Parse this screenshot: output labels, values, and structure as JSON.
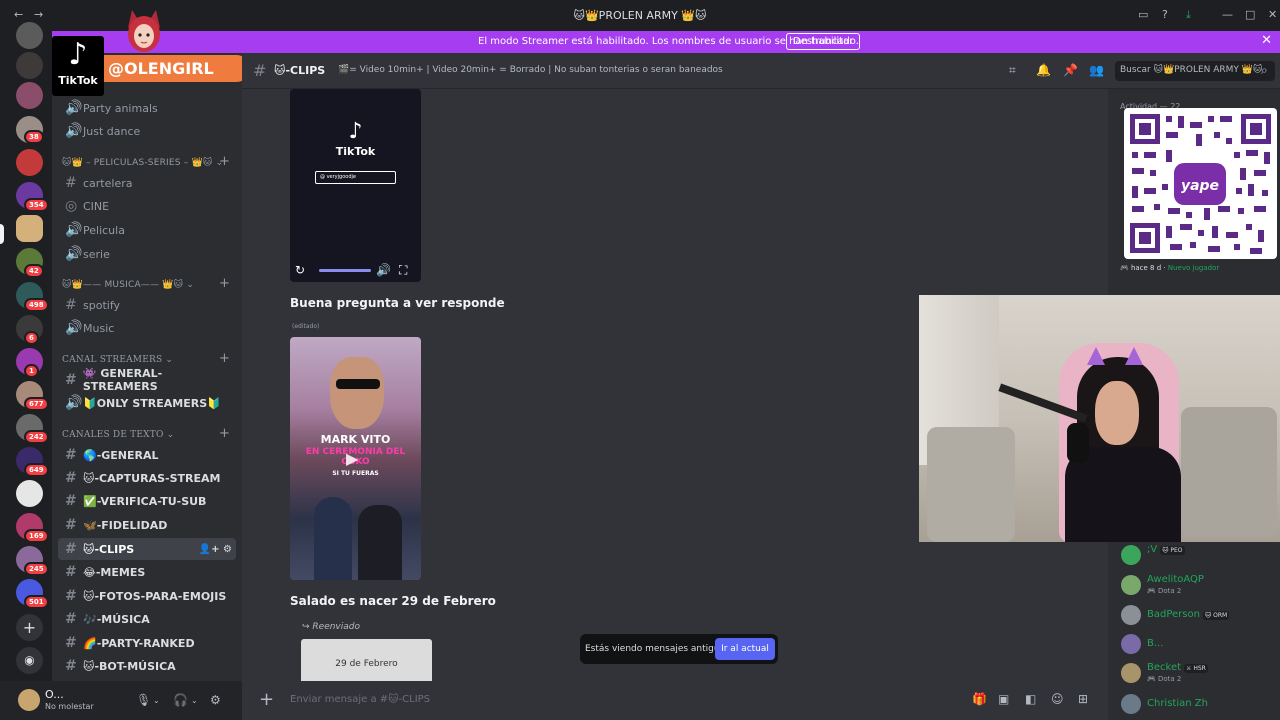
{
  "window": {
    "title": "🐱👑PROLEN ARMY 👑🐱",
    "back": "←",
    "forward": "→",
    "controls": [
      "▭",
      "?",
      "⤓",
      "—",
      "□",
      "✕"
    ]
  },
  "banner": {
    "text": "El modo Streamer está habilitado. Los nombres de usuario se han truncado.",
    "button": "Deshabilitar",
    "close": "✕"
  },
  "overlay": {
    "tiktok_label": "TikTok",
    "handle": "@OLENGIRL"
  },
  "servers": {
    "badges": [
      "38",
      "354",
      "42",
      "498",
      "6",
      "1",
      "677",
      "242",
      "649",
      "169",
      "245",
      "501"
    ],
    "add_icon": "+",
    "discover_icon": "◉"
  },
  "channels": {
    "items_top": [
      {
        "icon": "🔊",
        "label": "Party animals"
      },
      {
        "icon": "🔊",
        "label": "Just dance"
      }
    ],
    "cat_peliculas": "🐱👑 – PELICULAS-SERIES – 👑🐱",
    "peliculas": [
      {
        "icon": "#",
        "label": "cartelera"
      },
      {
        "icon": "◎",
        "label": "CINE"
      },
      {
        "icon": "🔊",
        "label": "Pelicula"
      },
      {
        "icon": "🔊",
        "label": "serie"
      }
    ],
    "cat_musica": "🐱👑—— MUSICA—— 👑🐱",
    "musica": [
      {
        "icon": "#",
        "label": "spotify"
      },
      {
        "icon": "🔊",
        "label": "Music"
      }
    ],
    "cat_streamers": "CANAL STREAMERS",
    "streamers": [
      {
        "icon": "#",
        "label": "👾 GENERAL-STREAMERS"
      },
      {
        "icon": "🔊",
        "label": "🔰ONLY STREAMERS🔰"
      }
    ],
    "cat_texto": "CANALES DE TEXTO",
    "texto": [
      {
        "icon": "#",
        "label": "🌎-GENERAL"
      },
      {
        "icon": "#",
        "label": "🐱-CAPTURAS-STREAM"
      },
      {
        "icon": "#",
        "label": "✅-VERIFICA-TU-SUB"
      },
      {
        "icon": "#",
        "label": "🦋-FIDELIDAD"
      },
      {
        "icon": "#",
        "label": "🐱-CLIPS"
      },
      {
        "icon": "#",
        "label": "😂-MEMES"
      },
      {
        "icon": "#",
        "label": "🐱-FOTOS-PARA-EMOJIS"
      },
      {
        "icon": "#",
        "label": "🎶-MÚSICA"
      },
      {
        "icon": "#",
        "label": "🌈-PARTY-RANKED"
      },
      {
        "icon": "#",
        "label": "🐱-BOT-MÚSICA"
      }
    ],
    "selected_tools": "👤+ ⚙"
  },
  "user": {
    "name": "O...",
    "status": "No molestar"
  },
  "header": {
    "hash": "#",
    "channel": "🐱-CLIPS",
    "topic": "🎬= Video 10min+ | Video 20min+ = Borrado | No suban tonterias o seran baneados",
    "search_placeholder": "Buscar 🐱👑PROLEN ARMY 👑🐱",
    "search_icon": "⌕"
  },
  "messages": {
    "video1": {
      "brand": "TikTok",
      "search_text": "@ veryjgoodje"
    },
    "msg1": "Buena pregunta a ver responde",
    "edited": "(editado)",
    "video2": {
      "line1": "MARK VITO",
      "line2": "EN CEREMONIA DEL OSKO",
      "line3": "SI TU FUERAS"
    },
    "msg2": "Salado es nacer 29 de Febrero",
    "forwarded": "↪ Reenviado",
    "forward_image_text": "29 de Febrero"
  },
  "old_messages": {
    "text": "Estás viendo mensajes antiguos",
    "button": "Ir al actual"
  },
  "composer": {
    "placeholder": "Enviar mensaje a #🐱-CLIPS"
  },
  "activity": {
    "label": "Actividad — 22",
    "footer_time": "hace 8 d",
    "footer_status": "Nuevo jugador"
  },
  "qr": {
    "brand": "yape"
  },
  "members": [
    {
      "name": ";V",
      "tag": "🐱 PEO",
      "sub": "",
      "color": "#3ba55c"
    },
    {
      "name": "AwelitoAQP",
      "tag": "",
      "sub": "🎮 Dota 2",
      "color": "#7aa86a"
    },
    {
      "name": "BadPerson",
      "tag": "🐱 ORM",
      "sub": "",
      "color": "#8b8f96"
    },
    {
      "name": "B...",
      "tag": "",
      "sub": "",
      "color": "#7a6aa8"
    },
    {
      "name": "Becket",
      "tag": "⚔ HSR",
      "sub": "🎮 Dota 2",
      "color": "#a8946a"
    },
    {
      "name": "Christian Zh",
      "tag": "",
      "sub": "",
      "color": "#6a7a88"
    }
  ]
}
